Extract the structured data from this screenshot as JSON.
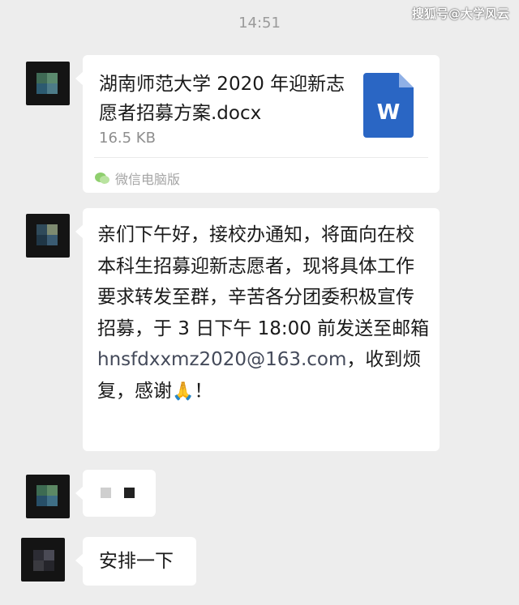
{
  "watermark": "搜狐号@大学风云",
  "timestamp": "14:51",
  "file_message": {
    "title": "湖南师范大学 2020 年迎新志愿者招募方案.docx",
    "size": "16.5 KB",
    "source": "微信电脑版",
    "file_icon_letter": "W",
    "file_icon_name": "word-document-icon",
    "source_icon_name": "wechat-icon",
    "accent_color": "#2a66c4"
  },
  "notice_message": {
    "text_before_email": "亲们下午好，接校办通知，将面向在校本科生招募迎新志愿者，现将具体工作要求转发至群，辛苦各分团委积极宣传招募，于 3 日下午 18:00 前发送至邮箱",
    "email": "hnsfdxxmz2020@163.com",
    "text_after_email": "，收到烦复，感谢",
    "emoji": "🙏",
    "text_end": "！"
  },
  "reply_message": {
    "text": "安排一下"
  },
  "colors": {
    "background": "#ededed",
    "bubble": "#ffffff",
    "timestamp": "#9b9b9b"
  }
}
